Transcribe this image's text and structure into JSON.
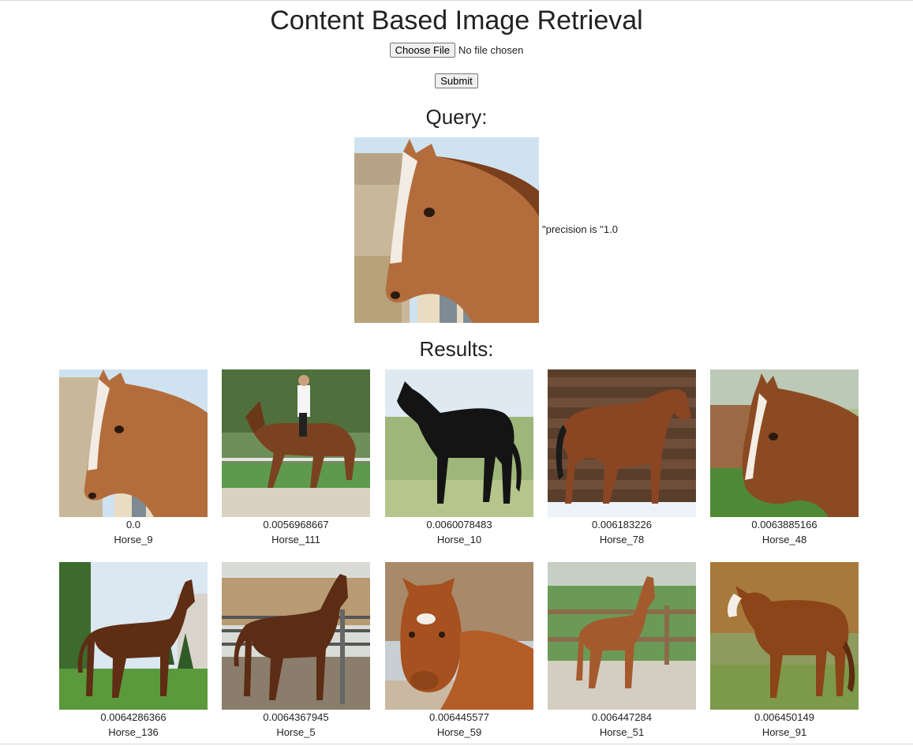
{
  "page": {
    "title": "Content Based Image Retrieval",
    "choose_file_label": "Choose File",
    "file_status": "No file chosen",
    "submit_label": "Submit",
    "query_heading": "Query:",
    "precision_text": "\"precision is \"1.0",
    "results_heading": "Results:"
  },
  "query_image": {
    "alt": "query-horse-image",
    "icon": "horse-head-photo"
  },
  "results": [
    {
      "score": "0.0",
      "label": "Horse_9"
    },
    {
      "score": "0.0056968667",
      "label": "Horse_111"
    },
    {
      "score": "0.0060078483",
      "label": "Horse_10"
    },
    {
      "score": "0.006183226",
      "label": "Horse_78"
    },
    {
      "score": "0.0063885166",
      "label": "Horse_48"
    },
    {
      "score": "0.0064286366",
      "label": "Horse_136"
    },
    {
      "score": "0.0064367945",
      "label": "Horse_5"
    },
    {
      "score": "0.006445577",
      "label": "Horse_59"
    },
    {
      "score": "0.006447284",
      "label": "Horse_51"
    },
    {
      "score": "0.006450149",
      "label": "Horse_91"
    }
  ]
}
